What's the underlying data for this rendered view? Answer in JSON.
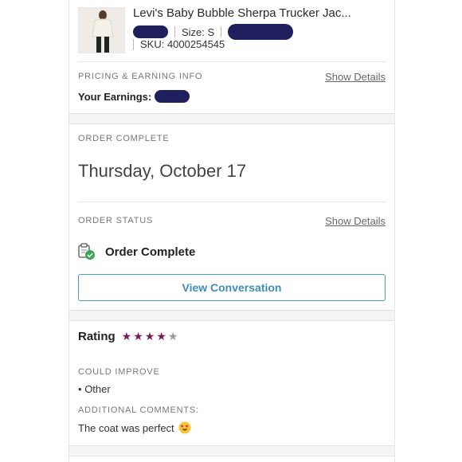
{
  "item": {
    "title": "Levi's Baby Bubble Sherpa Trucker Jac...",
    "size": "Size: S",
    "sku": "SKU: 4000254545"
  },
  "pricing": {
    "section_label": "PRICING & EARNING INFO",
    "show_details": "Show Details",
    "earnings_label": "Your Earnings:"
  },
  "order": {
    "section_label": "ORDER COMPLETE",
    "date": "Thursday, October 17",
    "status_label": "ORDER STATUS",
    "show_details": "Show Details",
    "status_text": "Order Complete",
    "button_label": "View Conversation"
  },
  "rating": {
    "label": "Rating",
    "stars_filled": 4,
    "stars_total": 5,
    "star_color": "#7a1a55",
    "star_empty_color": "#9a9a9a",
    "improve_label": "COULD IMPROVE",
    "improve_items": [
      "Other"
    ],
    "comments_label": "ADDITIONAL COMMENTS:",
    "comment": "The coat was perfect"
  },
  "colors": {
    "accent": "#3d8db8",
    "success": "#3aa655",
    "redaction": "#1f1f5e"
  }
}
